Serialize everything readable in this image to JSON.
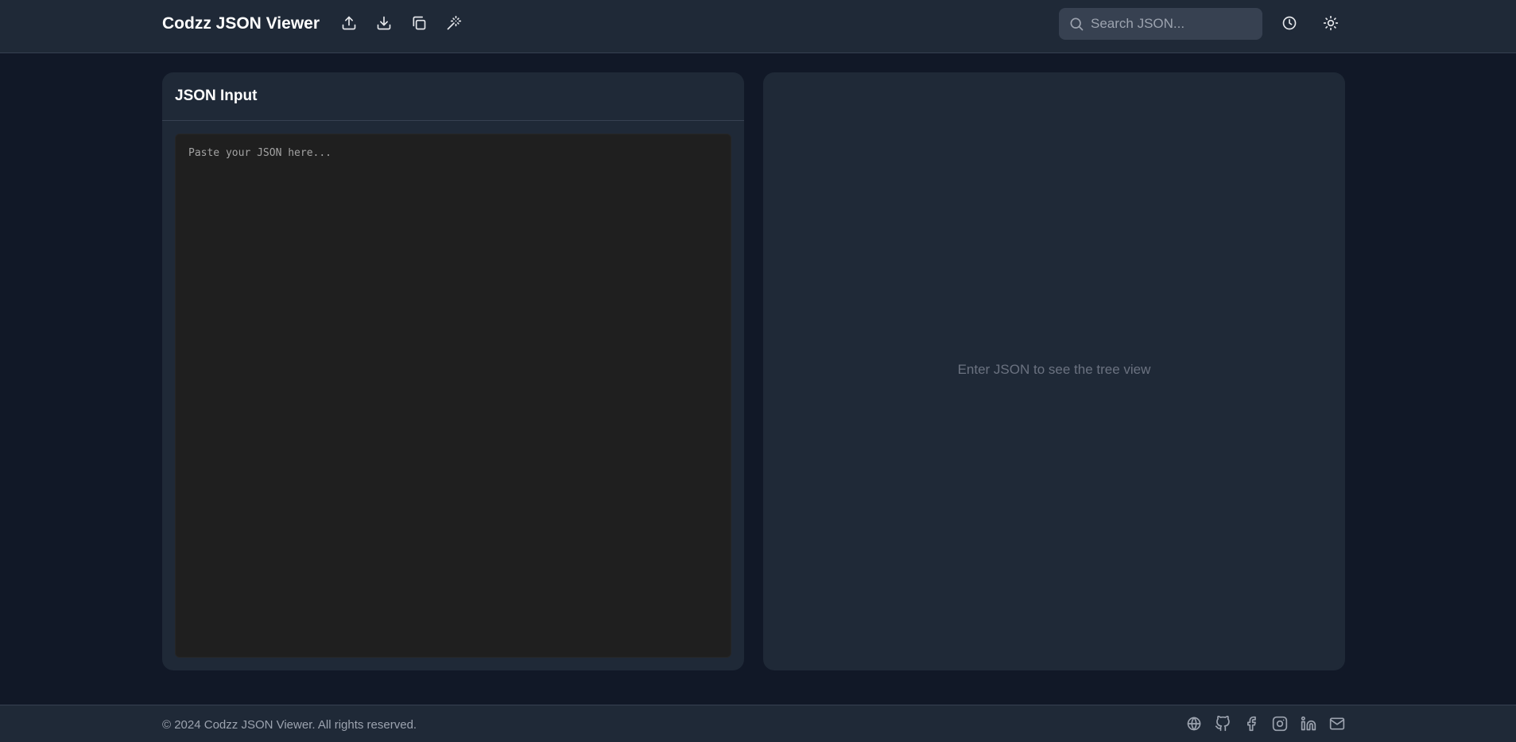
{
  "app": {
    "title": "Codzz JSON Viewer"
  },
  "toolbar": {
    "upload_icon": "upload-icon",
    "download_icon": "download-icon",
    "copy_icon": "copy-icon",
    "format_icon": "magic-wand-icon",
    "history_icon": "clock-icon",
    "theme_icon": "sun-icon"
  },
  "search": {
    "placeholder": "Search JSON..."
  },
  "input_panel": {
    "title": "JSON Input",
    "placeholder": "Paste your JSON here..."
  },
  "tree_panel": {
    "empty_message": "Enter JSON to see the tree view"
  },
  "footer": {
    "copyright": "© 2024 Codzz JSON Viewer. All rights reserved.",
    "socials": [
      "globe-icon",
      "github-icon",
      "facebook-icon",
      "instagram-icon",
      "linkedin-icon",
      "mail-icon"
    ]
  },
  "colors": {
    "background": "#111827",
    "surface": "#1f2937",
    "editor": "#1f1f1f",
    "muted_text": "#9ca3af"
  }
}
